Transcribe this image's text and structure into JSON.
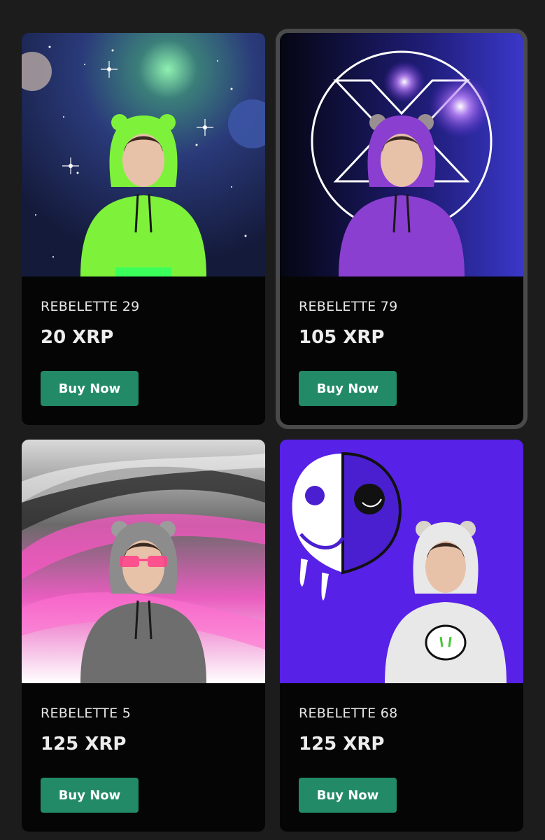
{
  "listings": [
    {
      "name": "REBELETTE 29",
      "price": "20 XRP",
      "button_label": "Buy Now",
      "hoodie_color": "#7ef23a",
      "theme": "space-galaxy"
    },
    {
      "name": "REBELETTE 79",
      "price": "105 XRP",
      "button_label": "Buy Now",
      "hoodie_color": "#8a3fd0",
      "theme": "xrp-logo-purple"
    },
    {
      "name": "REBELETTE 5",
      "price": "125 XRP",
      "button_label": "Buy Now",
      "hoodie_color": "#8c8c8c",
      "theme": "pink-waves"
    },
    {
      "name": "REBELETTE 68",
      "price": "125 XRP",
      "button_label": "Buy Now",
      "hoodie_color": "#e8e8e8",
      "theme": "purple-smiley-skull"
    }
  ],
  "colors": {
    "page_background": "#1c1c1c",
    "card_background": "#050505",
    "button": "#228a67",
    "selected_outline": "#4a4a4a"
  }
}
